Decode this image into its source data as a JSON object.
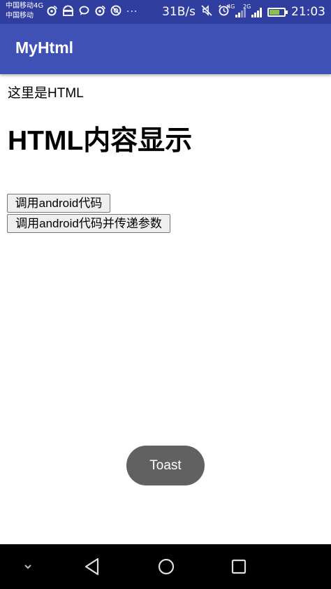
{
  "status_bar": {
    "carrier_1": "中国移动4G",
    "carrier_2": "中国移动",
    "net_speed": "31B/s",
    "signal_1_tag": "4G",
    "signal_2_tag": "2G",
    "time": "21:03",
    "battery_level": 0.7,
    "icons": [
      "weibo-icon",
      "android-debug-icon",
      "message-icon",
      "weibo-icon",
      "privacy-icon",
      "more-notifications-icon",
      "mute-icon",
      "alarm-icon",
      "signal-icon",
      "signal-icon",
      "battery-charging-icon"
    ]
  },
  "app_bar": {
    "title": "MyHtml",
    "color": "#3F51B5",
    "status_color": "#303F9F"
  },
  "webview": {
    "intro_text": "这里是HTML",
    "heading": "HTML内容显示",
    "buttons": [
      {
        "label": "调用android代码"
      },
      {
        "label": "调用android代码并传递参数"
      }
    ]
  },
  "toast": {
    "text": "Toast"
  },
  "nav_bar": {
    "icons": [
      "chevron-down-icon",
      "back-icon",
      "home-icon",
      "recents-icon"
    ]
  }
}
